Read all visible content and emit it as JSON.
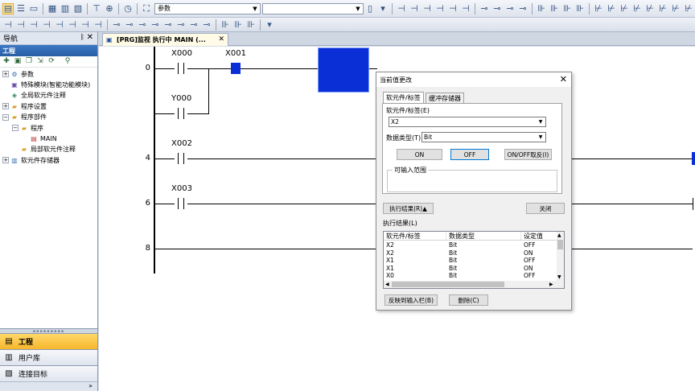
{
  "toolbar": {
    "search_combo_value": "参数"
  },
  "navigation": {
    "title": "导航",
    "pin": "ᛒ",
    "close": "✕",
    "section_label": "工程",
    "tree": [
      {
        "label": "参数",
        "toggle": "+",
        "indent": 0,
        "icon": "parameter-icon"
      },
      {
        "label": "特殊模块(智能功能模块)",
        "toggle": "",
        "indent": 0,
        "icon": "module-icon"
      },
      {
        "label": "全局软元件注释",
        "toggle": "",
        "indent": 0,
        "icon": "comment-icon"
      },
      {
        "label": "程序设置",
        "toggle": "+",
        "indent": 0,
        "icon": "folder-icon"
      },
      {
        "label": "程序部件",
        "toggle": "−",
        "indent": 0,
        "icon": "folder-icon"
      },
      {
        "label": "程序",
        "toggle": "−",
        "indent": 1,
        "icon": "folder-icon"
      },
      {
        "label": "MAIN",
        "toggle": "",
        "indent": 2,
        "icon": "program-icon"
      },
      {
        "label": "局部软元件注释",
        "toggle": "",
        "indent": 1,
        "icon": "folder-icon"
      },
      {
        "label": "软元件存储器",
        "toggle": "+",
        "indent": 0,
        "icon": "memory-icon"
      }
    ],
    "bottom_tabs": [
      {
        "label": "工程",
        "active": true
      },
      {
        "label": "用户库",
        "active": false
      },
      {
        "label": "连接目标",
        "active": false
      }
    ],
    "more": "»"
  },
  "editor": {
    "tab_label": "[PRG]监视 执行中 MAIN (...",
    "tab_close": "✕",
    "rungs": [
      "0",
      "4",
      "6",
      "8"
    ],
    "devices": {
      "x000": "X000",
      "x001": "X001",
      "y000": "Y000",
      "x002": "X002",
      "x003": "X003"
    }
  },
  "dialog": {
    "title": "当前值更改",
    "close": "✕",
    "tabs": [
      "软元件/标签",
      "缓冲存储器"
    ],
    "device_label": "软元件/标签(E)",
    "device_value": "X2",
    "datatype_label": "数据类型(T)",
    "datatype_value": "Bit",
    "btn_on": "ON",
    "btn_off": "OFF",
    "btn_toggle": "ON/OFF取反(I)",
    "input_range_label": "可输入范围",
    "exec_result_btn": "执行结果(R)▲",
    "close_btn": "关闭",
    "results_label": "执行结果(L)",
    "results_headers": [
      "软元件/标签",
      "数据类型",
      "设定值"
    ],
    "results_rows": [
      [
        "X2",
        "Bit",
        "OFF"
      ],
      [
        "X2",
        "Bit",
        "ON"
      ],
      [
        "X1",
        "Bit",
        "OFF"
      ],
      [
        "X1",
        "Bit",
        "ON"
      ],
      [
        "X0",
        "Bit",
        "OFF"
      ]
    ],
    "reflect_btn": "反映到输入栏(B)",
    "delete_btn": "删除(C)"
  }
}
